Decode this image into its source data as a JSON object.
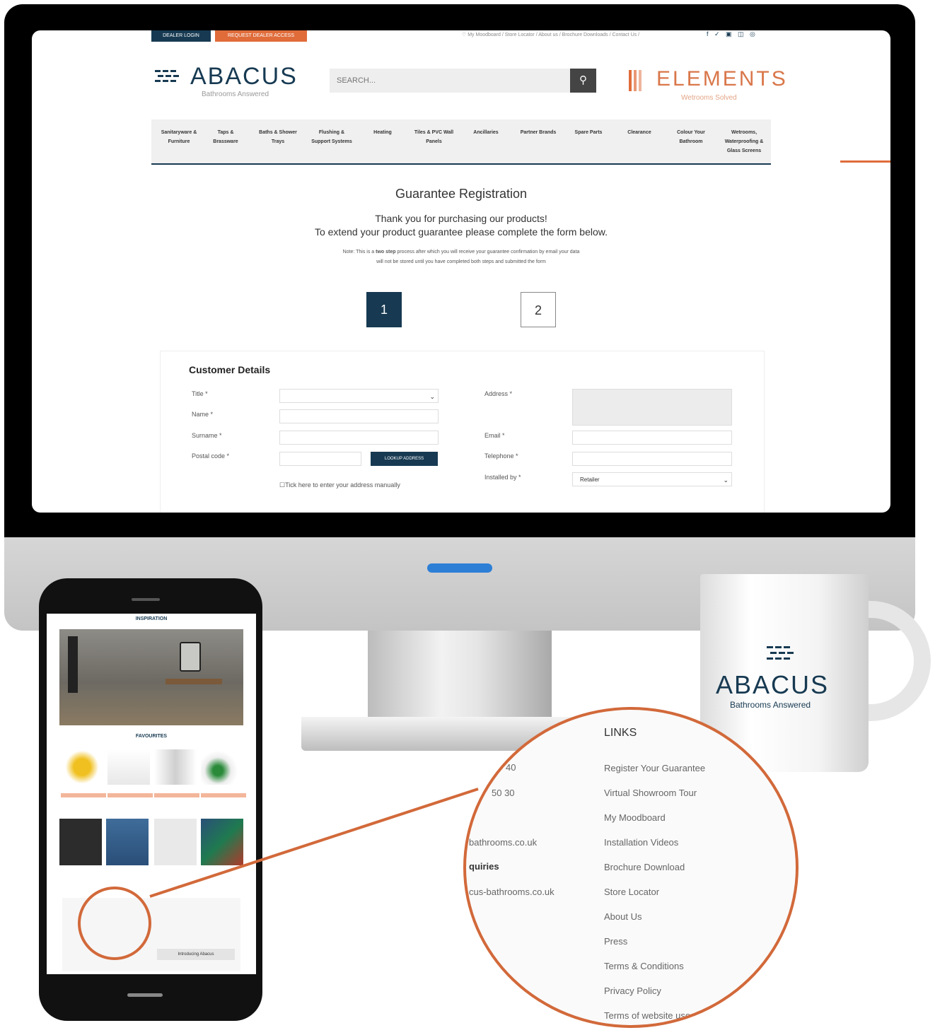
{
  "screen": {
    "top_buttons": {
      "dealer_login": "DEALER LOGIN",
      "request_access": "REQUEST DEALER ACCESS"
    },
    "utility_links": "♡ My Moodboard / Store Locator / About us / Brochure Downloads / Contact Us /",
    "social_icons": "f ✓ ▣ ◫ ◎",
    "brand": {
      "name": "ABACUS",
      "tagline": "Bathrooms Answered"
    },
    "search": {
      "placeholder": "SEARCH..."
    },
    "partner": {
      "name": "ELEMENTS",
      "tagline": "Wetrooms Solved"
    },
    "nav": [
      {
        "line1": "Sanitaryware &",
        "line2": "Furniture",
        "line3": ""
      },
      {
        "line1": "Taps &",
        "line2": "Brassware",
        "line3": ""
      },
      {
        "line1": "Baths & Shower",
        "line2": "Trays",
        "line3": ""
      },
      {
        "line1": "Flushing &",
        "line2": "Support Systems",
        "line3": ""
      },
      {
        "line1": "Heating",
        "line2": "",
        "line3": ""
      },
      {
        "line1": "Tiles & PVC Wall",
        "line2": "Panels",
        "line3": ""
      },
      {
        "line1": "Ancillaries",
        "line2": "",
        "line3": ""
      },
      {
        "line1": "Partner Brands",
        "line2": "",
        "line3": ""
      },
      {
        "line1": "Spare Parts",
        "line2": "",
        "line3": ""
      },
      {
        "line1": "Clearance",
        "line2": "",
        "line3": ""
      },
      {
        "line1": "Colour Your",
        "line2": "Bathroom",
        "line3": ""
      },
      {
        "line1": "Wetrooms,",
        "line2": "Waterproofing &",
        "line3": "Glass Screens"
      }
    ],
    "page_title": "Guarantee Registration",
    "intro_line1": "Thank you for purchasing our products!",
    "intro_line2": "To extend your product guarantee please complete the form below.",
    "note_pre": "Note: This is a ",
    "note_bold": "two step",
    "note_post": " process after which you will receive your guarantee confirmation by email your data",
    "note_line2": "will not be stored until you have completed both steps and submitted the form",
    "steps": [
      "1",
      "2"
    ],
    "form": {
      "heading": "Customer Details",
      "title_label": "Title *",
      "name_label": "Name *",
      "surname_label": "Surname *",
      "postal_label": "Postal code *",
      "lookup_button": "LOOKUP ADDRESS",
      "manual_checkbox": "Tick here to enter your address manually",
      "address_label": "Address *",
      "email_label": "Email *",
      "telephone_label": "Telephone *",
      "installed_label": "Installed by *",
      "installed_value": "Retailer"
    }
  },
  "phone": {
    "inspiration": "INSPIRATION",
    "favourites": "FAVOURITES",
    "footer_button": "Introducing Abacus"
  },
  "zoom": {
    "links_heading": "LINKS",
    "left_fragments": [
      "40",
      "50 30",
      "bathrooms.co.uk",
      "quiries",
      "cus-bathrooms.co.uk"
    ],
    "links": [
      "Register Your Guarantee",
      "Virtual Showroom Tour",
      "My Moodboard",
      "Installation Videos",
      "Brochure Download",
      "Store Locator",
      "About Us",
      "Press",
      "Terms & Conditions",
      "Privacy Policy",
      "Terms of website use"
    ]
  },
  "mug": {
    "brand": "ABACUS",
    "tagline": "Bathrooms Answered"
  },
  "colors": {
    "navy": "#173a52",
    "orange": "#e06c3a",
    "accent_blue": "#2d7fd6"
  }
}
